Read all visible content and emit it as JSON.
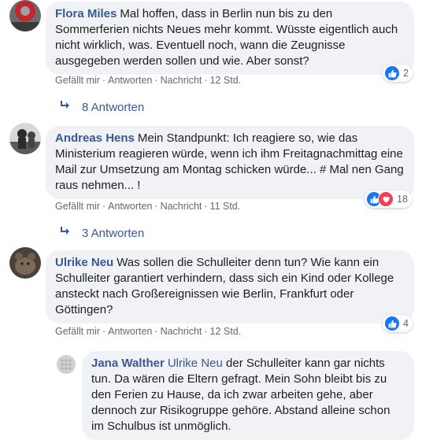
{
  "comments": [
    {
      "author": "Flora Miles",
      "text": "Mal hoffen, dass in Berlin nun bis zu den Sommerferien nichts Neues mehr kommt. Wüsste eigentlich auch nicht wirklich, was. Eventuell noch, wann die Zeugnisse ausgegeben werden sollen und wie. Aber sonst?",
      "actions": {
        "like": "Gefällt mir",
        "reply": "Antworten",
        "message": "Nachricht",
        "time": "12 Std."
      },
      "reaction_count": "2",
      "replies_label": "8 Antworten"
    },
    {
      "author": "Andreas Hens",
      "text": "Mein Standpunkt: Ich reagiere so, wie das Ministerium reagieren würde, wenn ich ihm Freitagnachmittag eine Mail zur Umsetzung am Montag schicken würde... # Mal nen Gang raus nehmen... !",
      "actions": {
        "like": "Gefällt mir",
        "reply": "Antworten",
        "message": "Nachricht",
        "time": "11 Std."
      },
      "reaction_count": "18",
      "replies_label": "3 Antworten"
    },
    {
      "author": "Ulrike Neu",
      "text": "Was sollen die Schulleiter denn tun? Wie kann ein Schulleiter garantiert verhindern, dass sich ein Kind oder Kollege ansteckt nach Großereignissen wie Berlin, Frankfurt oder Göttingen?",
      "actions": {
        "like": "Gefällt mir",
        "reply": "Antworten",
        "message": "Nachricht",
        "time": "12 Std."
      },
      "reaction_count": "4"
    }
  ],
  "reply": {
    "author": "Jana Walther",
    "mention": "Ulrike Neu",
    "text": "der Schulleiter kann gar nichts tun. Da wären die Eltern gefragt. Mein Sohn bleibt bis zu den Ferien zu Hause, da ich zwar arbeiten gehe, aber dennoch zur Risikogruppe gehöre. Abstand alleine schon im Schulbus ist unmöglich."
  },
  "colors": {
    "link": "#385898",
    "bubble": "#f0f2f5",
    "meta": "#65676b",
    "like": "#1877f2",
    "love": "#f33e58"
  },
  "icons": {
    "like": "thumbs-up-icon",
    "love": "heart-icon",
    "reply_arrow": "reply-arrow-icon"
  }
}
